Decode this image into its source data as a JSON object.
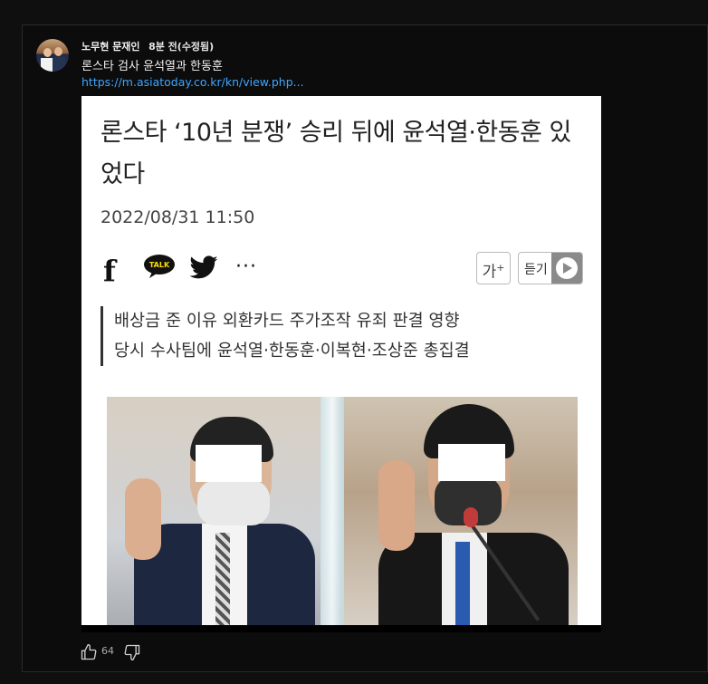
{
  "comment": {
    "author": "노무현 문재인",
    "time": "8분 전(수정됨)",
    "text": "론스타 검사 윤석열과 한동훈",
    "link": "https://m.asiatoday.co.kr/kn/view.php..."
  },
  "article": {
    "headline": "론스타 ‘10년 분쟁’ 승리 뒤에 윤석열·한동훈 있었다",
    "date": "2022/08/31 11:50",
    "share_icons": {
      "facebook": "f",
      "kakaotalk": "TALK",
      "more": "···"
    },
    "font_button": "가",
    "font_button_sup": "+",
    "listen_label": "듣기",
    "subtitle_lines": [
      "배상금 준 이유 외환카드 주가조작 유죄 판결 영향",
      "당시 수사팀에 윤석열·한동훈·이복현·조상준 총집결"
    ]
  },
  "actions": {
    "like_count": "64"
  },
  "colors": {
    "background": "#0f0f0f",
    "link": "#3ea6ff",
    "text": "#f1f1f1"
  }
}
